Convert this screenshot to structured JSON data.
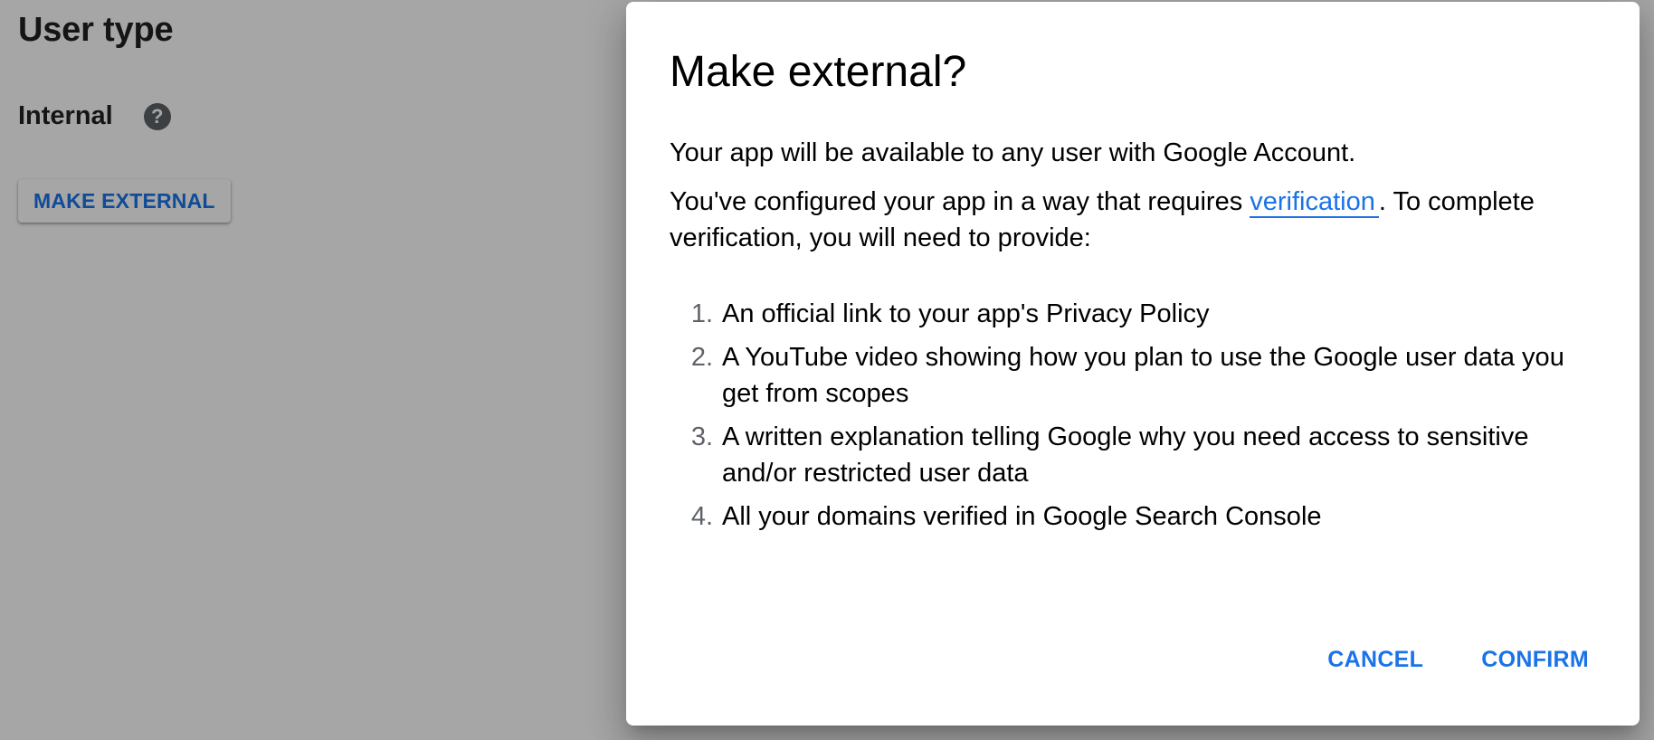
{
  "page": {
    "section_title": "User type",
    "user_type_label": "Internal",
    "help_glyph": "?",
    "make_external_label": "MAKE EXTERNAL"
  },
  "dialog": {
    "title": "Make external?",
    "availability_text": "Your app will be available to any user with Google Account.",
    "verification_prefix": "You've configured your app in a way that requires ",
    "verification_link": "verification",
    "verification_suffix": ". To complete verification, you will need to provide:",
    "requirements": [
      {
        "num": "1.",
        "text": "An official link to your app's Privacy Policy"
      },
      {
        "num": "2.",
        "text": "A YouTube video showing how you plan to use the Google user data you get from scopes"
      },
      {
        "num": "3.",
        "text": "A written explanation telling Google why you need access to sensitive and/or restricted user data"
      },
      {
        "num": "4.",
        "text": "All your domains verified in Google Search Console"
      }
    ],
    "cancel_label": "CANCEL",
    "confirm_label": "CONFIRM"
  },
  "colors": {
    "accent": "#1a73e8",
    "scrim": "rgba(0,0,0,0.35)",
    "icon_gray": "#5f6368"
  },
  "icons": {
    "help": "help-circle-icon"
  }
}
